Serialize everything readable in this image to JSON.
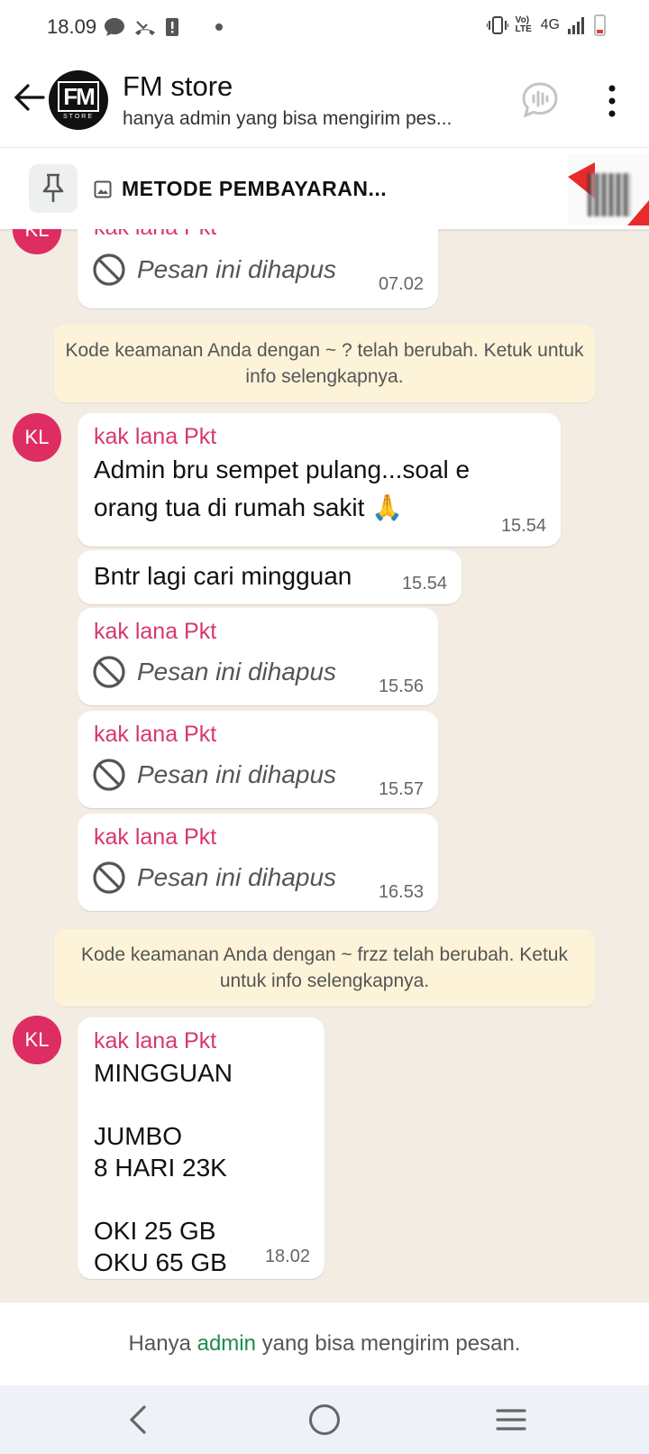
{
  "status_bar": {
    "time": "18.09",
    "network": "4G",
    "volte": "Vo) LTE"
  },
  "header": {
    "avatar_text": "FM",
    "avatar_subtext": "STORE",
    "title": "FM store",
    "subtitle": "hanya admin yang bisa mengirim pes..."
  },
  "pinned": {
    "text": "METODE PEMBAYARAN..."
  },
  "messages": [
    {
      "avatar": "KL",
      "sender": "kak lana Pkt",
      "deleted": "Pesan ini dihapus",
      "time": "07.02"
    },
    {
      "system": "Kode keamanan Anda dengan ~ ? telah berubah. Ketuk untuk info selengkapnya."
    },
    {
      "avatar": "KL",
      "sender": "kak lana Pkt",
      "text": "Admin bru sempet pulang...soal e\norang tua di rumah sakit 🙏",
      "time": "15.54"
    },
    {
      "text": "Bntr lagi cari mingguan",
      "time": "15.54"
    },
    {
      "sender": "kak lana Pkt",
      "deleted": "Pesan ini dihapus",
      "time": "15.56"
    },
    {
      "sender": "kak lana Pkt",
      "deleted": "Pesan ini dihapus",
      "time": "15.57"
    },
    {
      "sender": "kak lana Pkt",
      "deleted": "Pesan ini dihapus",
      "time": "16.53"
    },
    {
      "system": "Kode keamanan Anda dengan ~ frzz telah berubah. Ketuk untuk info selengkapnya."
    },
    {
      "avatar": "KL",
      "sender": "kak lana Pkt",
      "text": "MINGGUAN\n\nJUMBO\n8 HARI 23K\n\nOKI 25 GB\nOKU 65 GB",
      "time": "18.02"
    }
  ],
  "footer": {
    "prefix": "Hanya ",
    "link": "admin",
    "suffix": " yang bisa mengirim pesan."
  },
  "colors": {
    "sender": "#d7386c",
    "avatar": "#dd2d62",
    "system_bg": "#fdf3d8",
    "admin_link": "#1f8a52",
    "chat_bg": "#f3ece3"
  }
}
